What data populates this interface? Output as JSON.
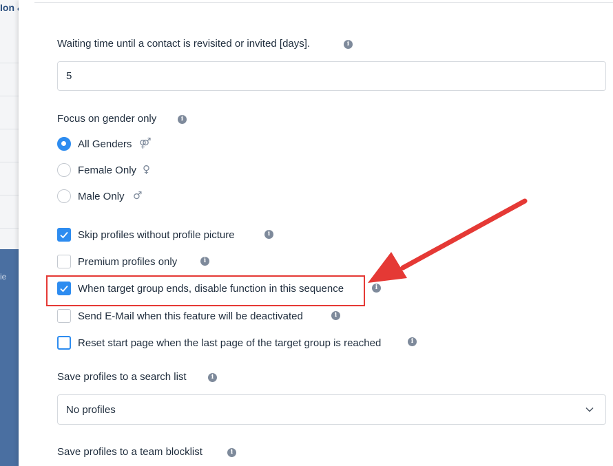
{
  "background": {
    "top_text": "Ion &",
    "side_text": "ie"
  },
  "waiting": {
    "label": "Waiting time until a contact is revisited or invited [days].",
    "value": "5"
  },
  "gender": {
    "label": "Focus on gender only",
    "options": [
      {
        "label": "All Genders",
        "symbol": "⚤",
        "selected": true
      },
      {
        "label": "Female Only",
        "symbol": "♀",
        "selected": false
      },
      {
        "label": "Male Only",
        "symbol": "♂",
        "selected": false
      }
    ]
  },
  "checkboxes": [
    {
      "label": "Skip profiles without profile picture",
      "checked": true
    },
    {
      "label": "Premium profiles only",
      "checked": false
    },
    {
      "label": "When target group ends, disable function in this sequence",
      "checked": true
    },
    {
      "label": "Send E-Mail when this feature will be deactivated",
      "checked": false
    },
    {
      "label": "Reset start page when the last page of the target group is reached",
      "checked": false
    }
  ],
  "search_list": {
    "label": "Save profiles to a search list",
    "value": "No profiles"
  },
  "blocklist": {
    "label": "Save profiles to a team blocklist"
  },
  "info_glyph": "i",
  "colors": {
    "accent": "#2d8cf0",
    "annotation": "#e53935",
    "sidebar_blue": "#4a6fa1"
  }
}
